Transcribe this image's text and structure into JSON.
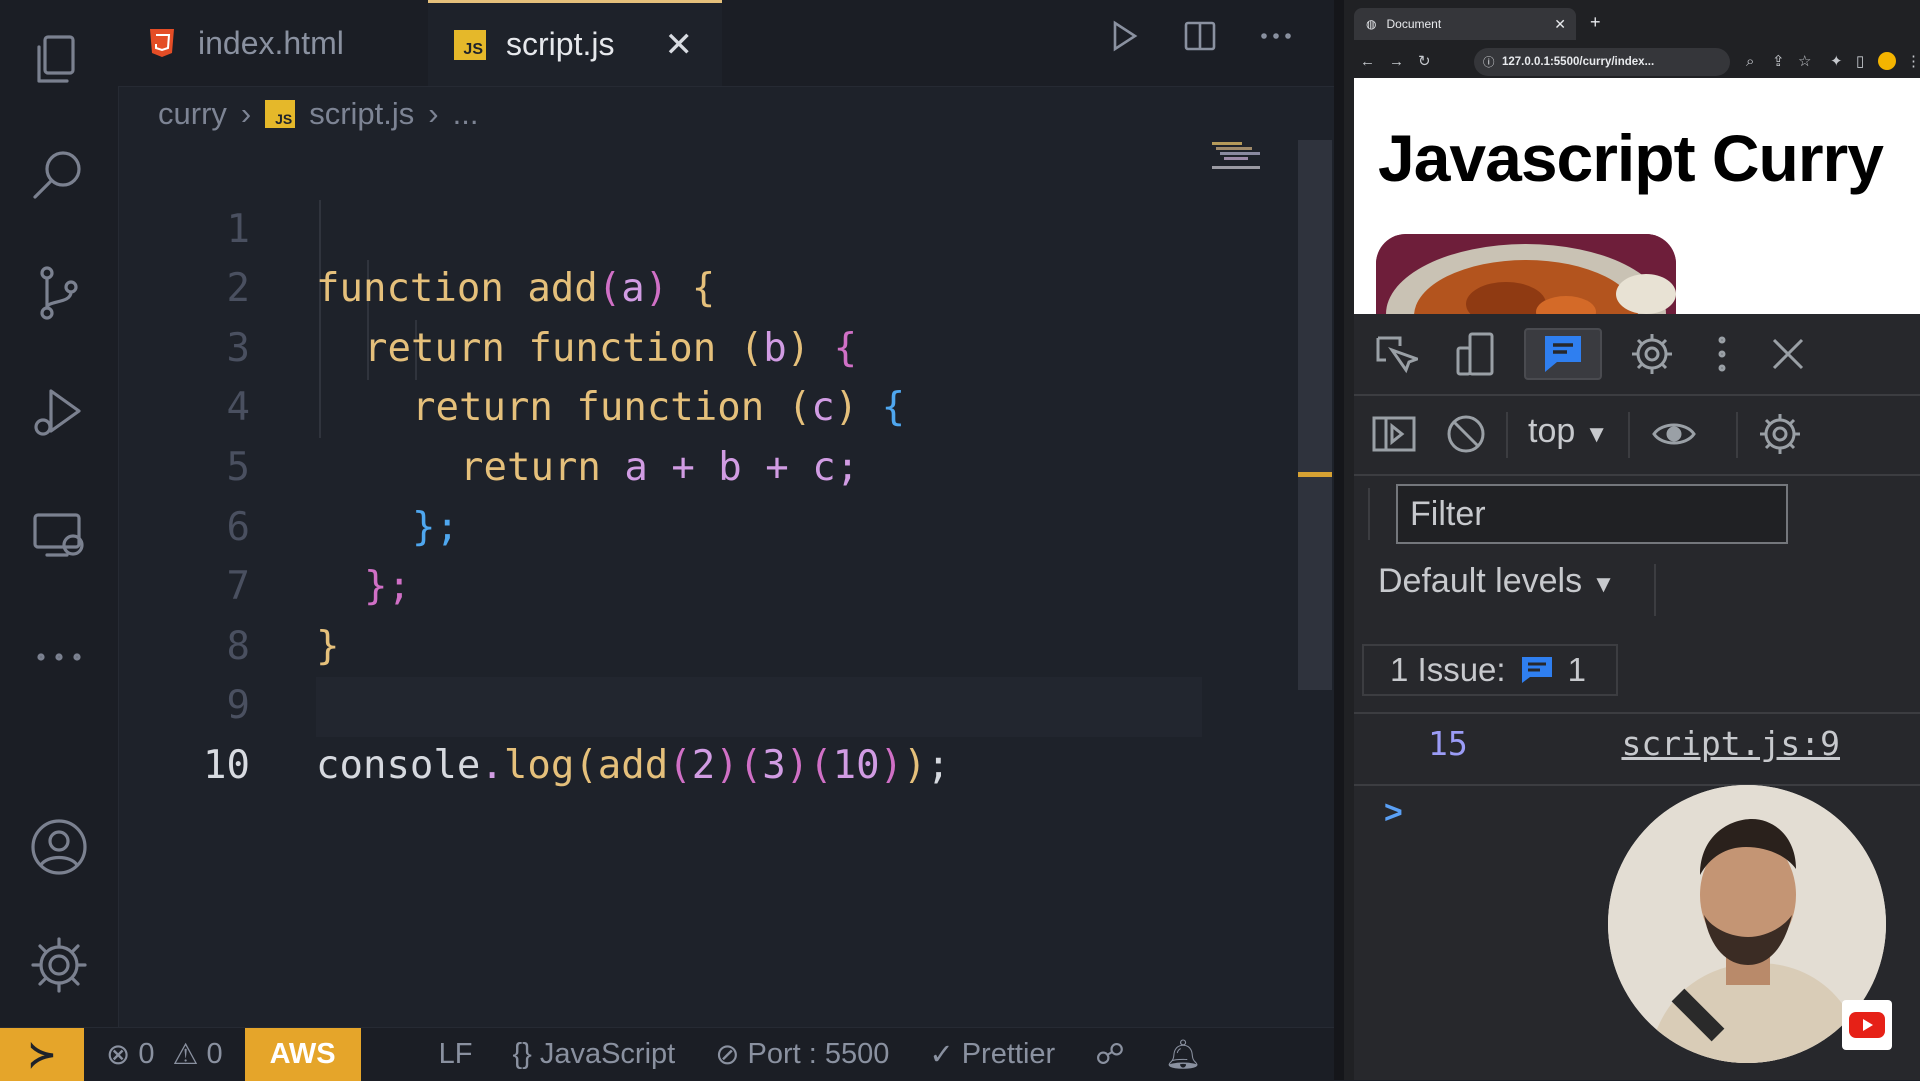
{
  "editor": {
    "tabs": [
      {
        "label": "index.html",
        "icon": "html5-icon"
      },
      {
        "label": "script.js",
        "icon": "js-icon",
        "close": "✕"
      }
    ],
    "breadcrumb": {
      "folder": "curry",
      "file": "script.js",
      "more": "..."
    },
    "lines": [
      "1",
      "2",
      "3",
      "4",
      "5",
      "6",
      "7",
      "8",
      "9",
      "10"
    ],
    "code": {
      "l1": {
        "kw": "function",
        "fn": "add",
        "arg": "a",
        "brace": "{"
      },
      "l2": {
        "kw": "return",
        "kw2": "function",
        "arg": "b",
        "brace": "{"
      },
      "l3": {
        "kw": "return",
        "kw2": "function",
        "arg": "c",
        "brace": "{"
      },
      "l4": {
        "kw": "return",
        "expr": "a + b + c;"
      },
      "l5": {
        "text": "};"
      },
      "l6": {
        "text": "};"
      },
      "l7": {
        "text": "}"
      },
      "l9": {
        "obj": "console",
        "method": "log",
        "call": "add",
        "a1": "2",
        "a2": "3",
        "a3": "10"
      }
    }
  },
  "statusbar": {
    "errors": "0",
    "warnings": "0",
    "aws": "AWS",
    "eol": "LF",
    "language": "JavaScript",
    "port": "Port : 5500",
    "prettier": "Prettier"
  },
  "browser": {
    "tab_title": "Document",
    "url": "127.0.0.1:5500/curry/index...",
    "heading": "Javascript Curry"
  },
  "devtools": {
    "context": "top",
    "filter_placeholder": "Filter",
    "levels": "Default levels",
    "issues_label": "1 Issue:",
    "issues_count": "1",
    "output_value": "15",
    "output_source": "script.js:9",
    "prompt": ">"
  },
  "colors": {
    "accent": "#e5a52a",
    "keyword": "#e5c07b",
    "console_value": "#9b9cf6"
  }
}
